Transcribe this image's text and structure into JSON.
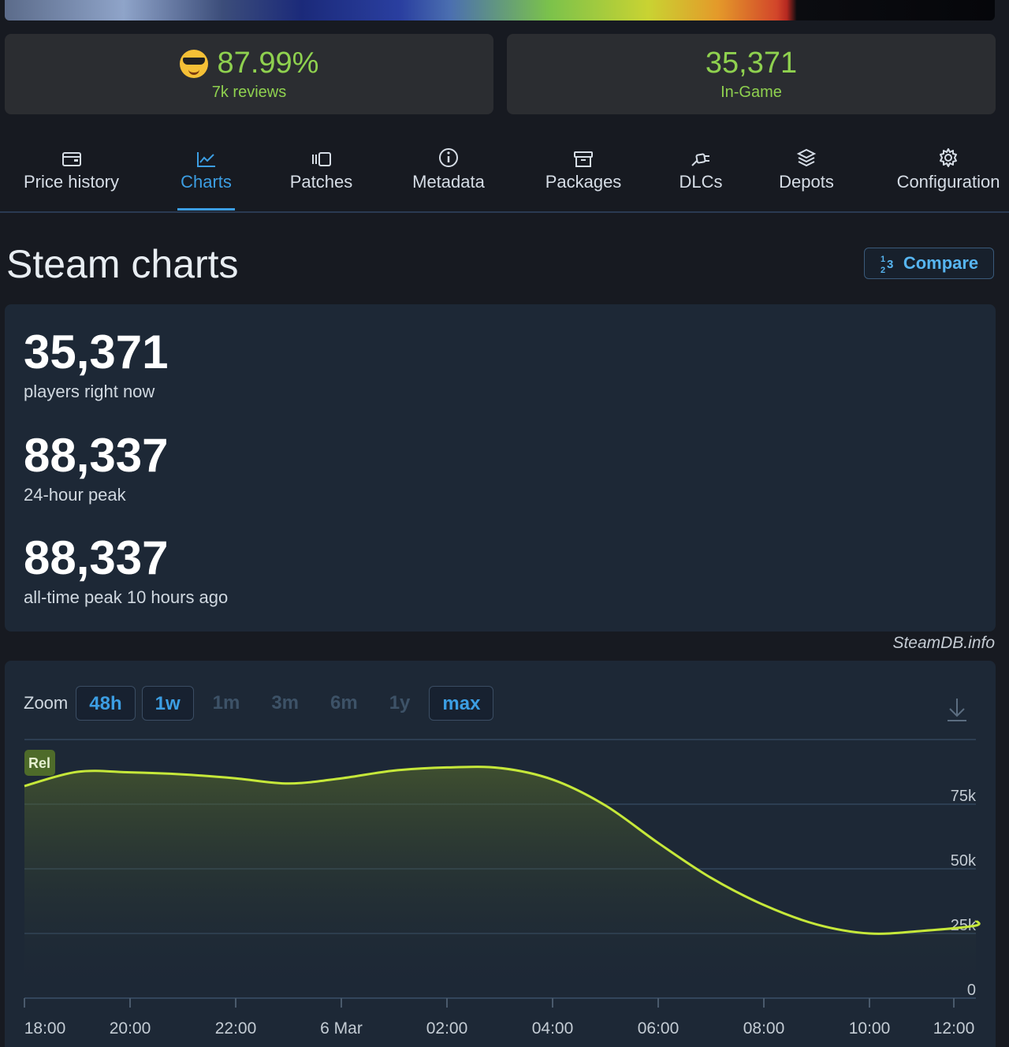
{
  "stats": {
    "rating": "87.99%",
    "reviews": "7k reviews",
    "ingame_count": "35,371",
    "ingame_label": "In-Game"
  },
  "tabs": [
    {
      "label": "Price history",
      "icon": "wallet-icon",
      "active": false
    },
    {
      "label": "Charts",
      "icon": "line-chart-icon",
      "active": true
    },
    {
      "label": "Patches",
      "icon": "patches-icon",
      "active": false
    },
    {
      "label": "Metadata",
      "icon": "info-icon",
      "active": false
    },
    {
      "label": "Packages",
      "icon": "archive-icon",
      "active": false
    },
    {
      "label": "DLCs",
      "icon": "plug-icon",
      "active": false
    },
    {
      "label": "Depots",
      "icon": "layers-icon",
      "active": false
    },
    {
      "label": "Configuration",
      "icon": "gear-icon",
      "active": false
    }
  ],
  "section": {
    "title": "Steam charts",
    "compare_label": "Compare"
  },
  "summary": {
    "current": "35,371",
    "current_label": "players right now",
    "peak24": "88,337",
    "peak24_label": "24-hour peak",
    "alltime": "88,337",
    "alltime_label": "all-time peak 10 hours ago"
  },
  "credit": "SteamDB.info",
  "zoom": {
    "label": "Zoom",
    "options": [
      {
        "label": "48h",
        "state": "boxed"
      },
      {
        "label": "1w",
        "state": "boxed"
      },
      {
        "label": "1m",
        "state": "disabled"
      },
      {
        "label": "3m",
        "state": "disabled"
      },
      {
        "label": "6m",
        "state": "disabled"
      },
      {
        "label": "1y",
        "state": "disabled"
      },
      {
        "label": "max",
        "state": "boxed"
      }
    ]
  },
  "colors": {
    "accent": "#3c9ee3",
    "positive": "#8fd14f",
    "line": "#c6e83a",
    "marker": "#4e6b2a"
  },
  "chart_data": {
    "type": "line",
    "marker_label": "Rel",
    "x_ticks": [
      "18:00",
      "20:00",
      "22:00",
      "6 Mar",
      "02:00",
      "04:00",
      "06:00",
      "08:00",
      "10:00",
      "12:00"
    ],
    "y_ticks": [
      "0",
      "25k",
      "50k",
      "75k"
    ],
    "ylim": [
      0,
      100000
    ],
    "grid": true,
    "series": [
      {
        "x": [
          "17:00",
          "18:00",
          "19:00",
          "20:00",
          "21:00",
          "22:00",
          "23:00",
          "6 Mar 00:00",
          "01:00",
          "02:00",
          "03:00",
          "04:00",
          "05:00",
          "06:00",
          "07:00",
          "08:00",
          "09:00",
          "10:00",
          "11:00",
          "12:00"
        ],
        "values": [
          82000,
          87500,
          87300,
          86500,
          85000,
          83000,
          85000,
          88000,
          89200,
          89000,
          84500,
          74500,
          60000,
          46500,
          36000,
          28500,
          25000,
          26000,
          28000,
          30000
        ]
      }
    ]
  }
}
